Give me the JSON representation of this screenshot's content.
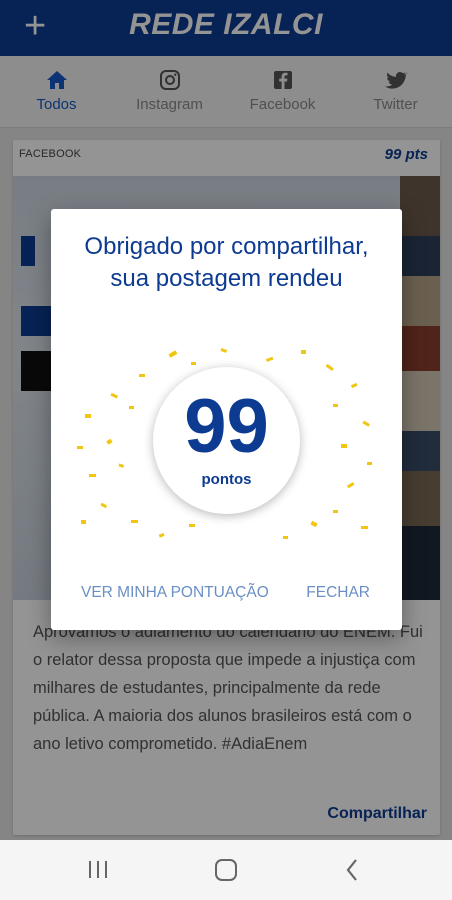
{
  "app": {
    "title": "REDE IZALCI"
  },
  "tabs": [
    {
      "label": "Todos",
      "icon": "home-icon",
      "active": true
    },
    {
      "label": "Instagram",
      "icon": "instagram-icon"
    },
    {
      "label": "Facebook",
      "icon": "facebook-icon"
    },
    {
      "label": "Twitter",
      "icon": "twitter-icon"
    }
  ],
  "post": {
    "source": "FACEBOOK",
    "points": "99 pts",
    "body": "Aprovamos o adiamento do calendário do ENEM. Fui o relator dessa proposta que impede a injustiça com milhares de estudantes, principalmente da rede pública. A maioria dos alunos brasileiros está com o ano letivo comprometido. #AdiaEnem",
    "share_label": "Compartilhar"
  },
  "dialog": {
    "message": "Obrigado por compartilhar, sua postagem rendeu",
    "points_value": "99",
    "points_unit": "pontos",
    "view_score_button": "VER MINHA PONTUAÇÃO",
    "close_button": "FECHAR"
  },
  "colors": {
    "primary": "#0d3b91",
    "accent": "#1559c7",
    "confetti": "#f2c511"
  }
}
